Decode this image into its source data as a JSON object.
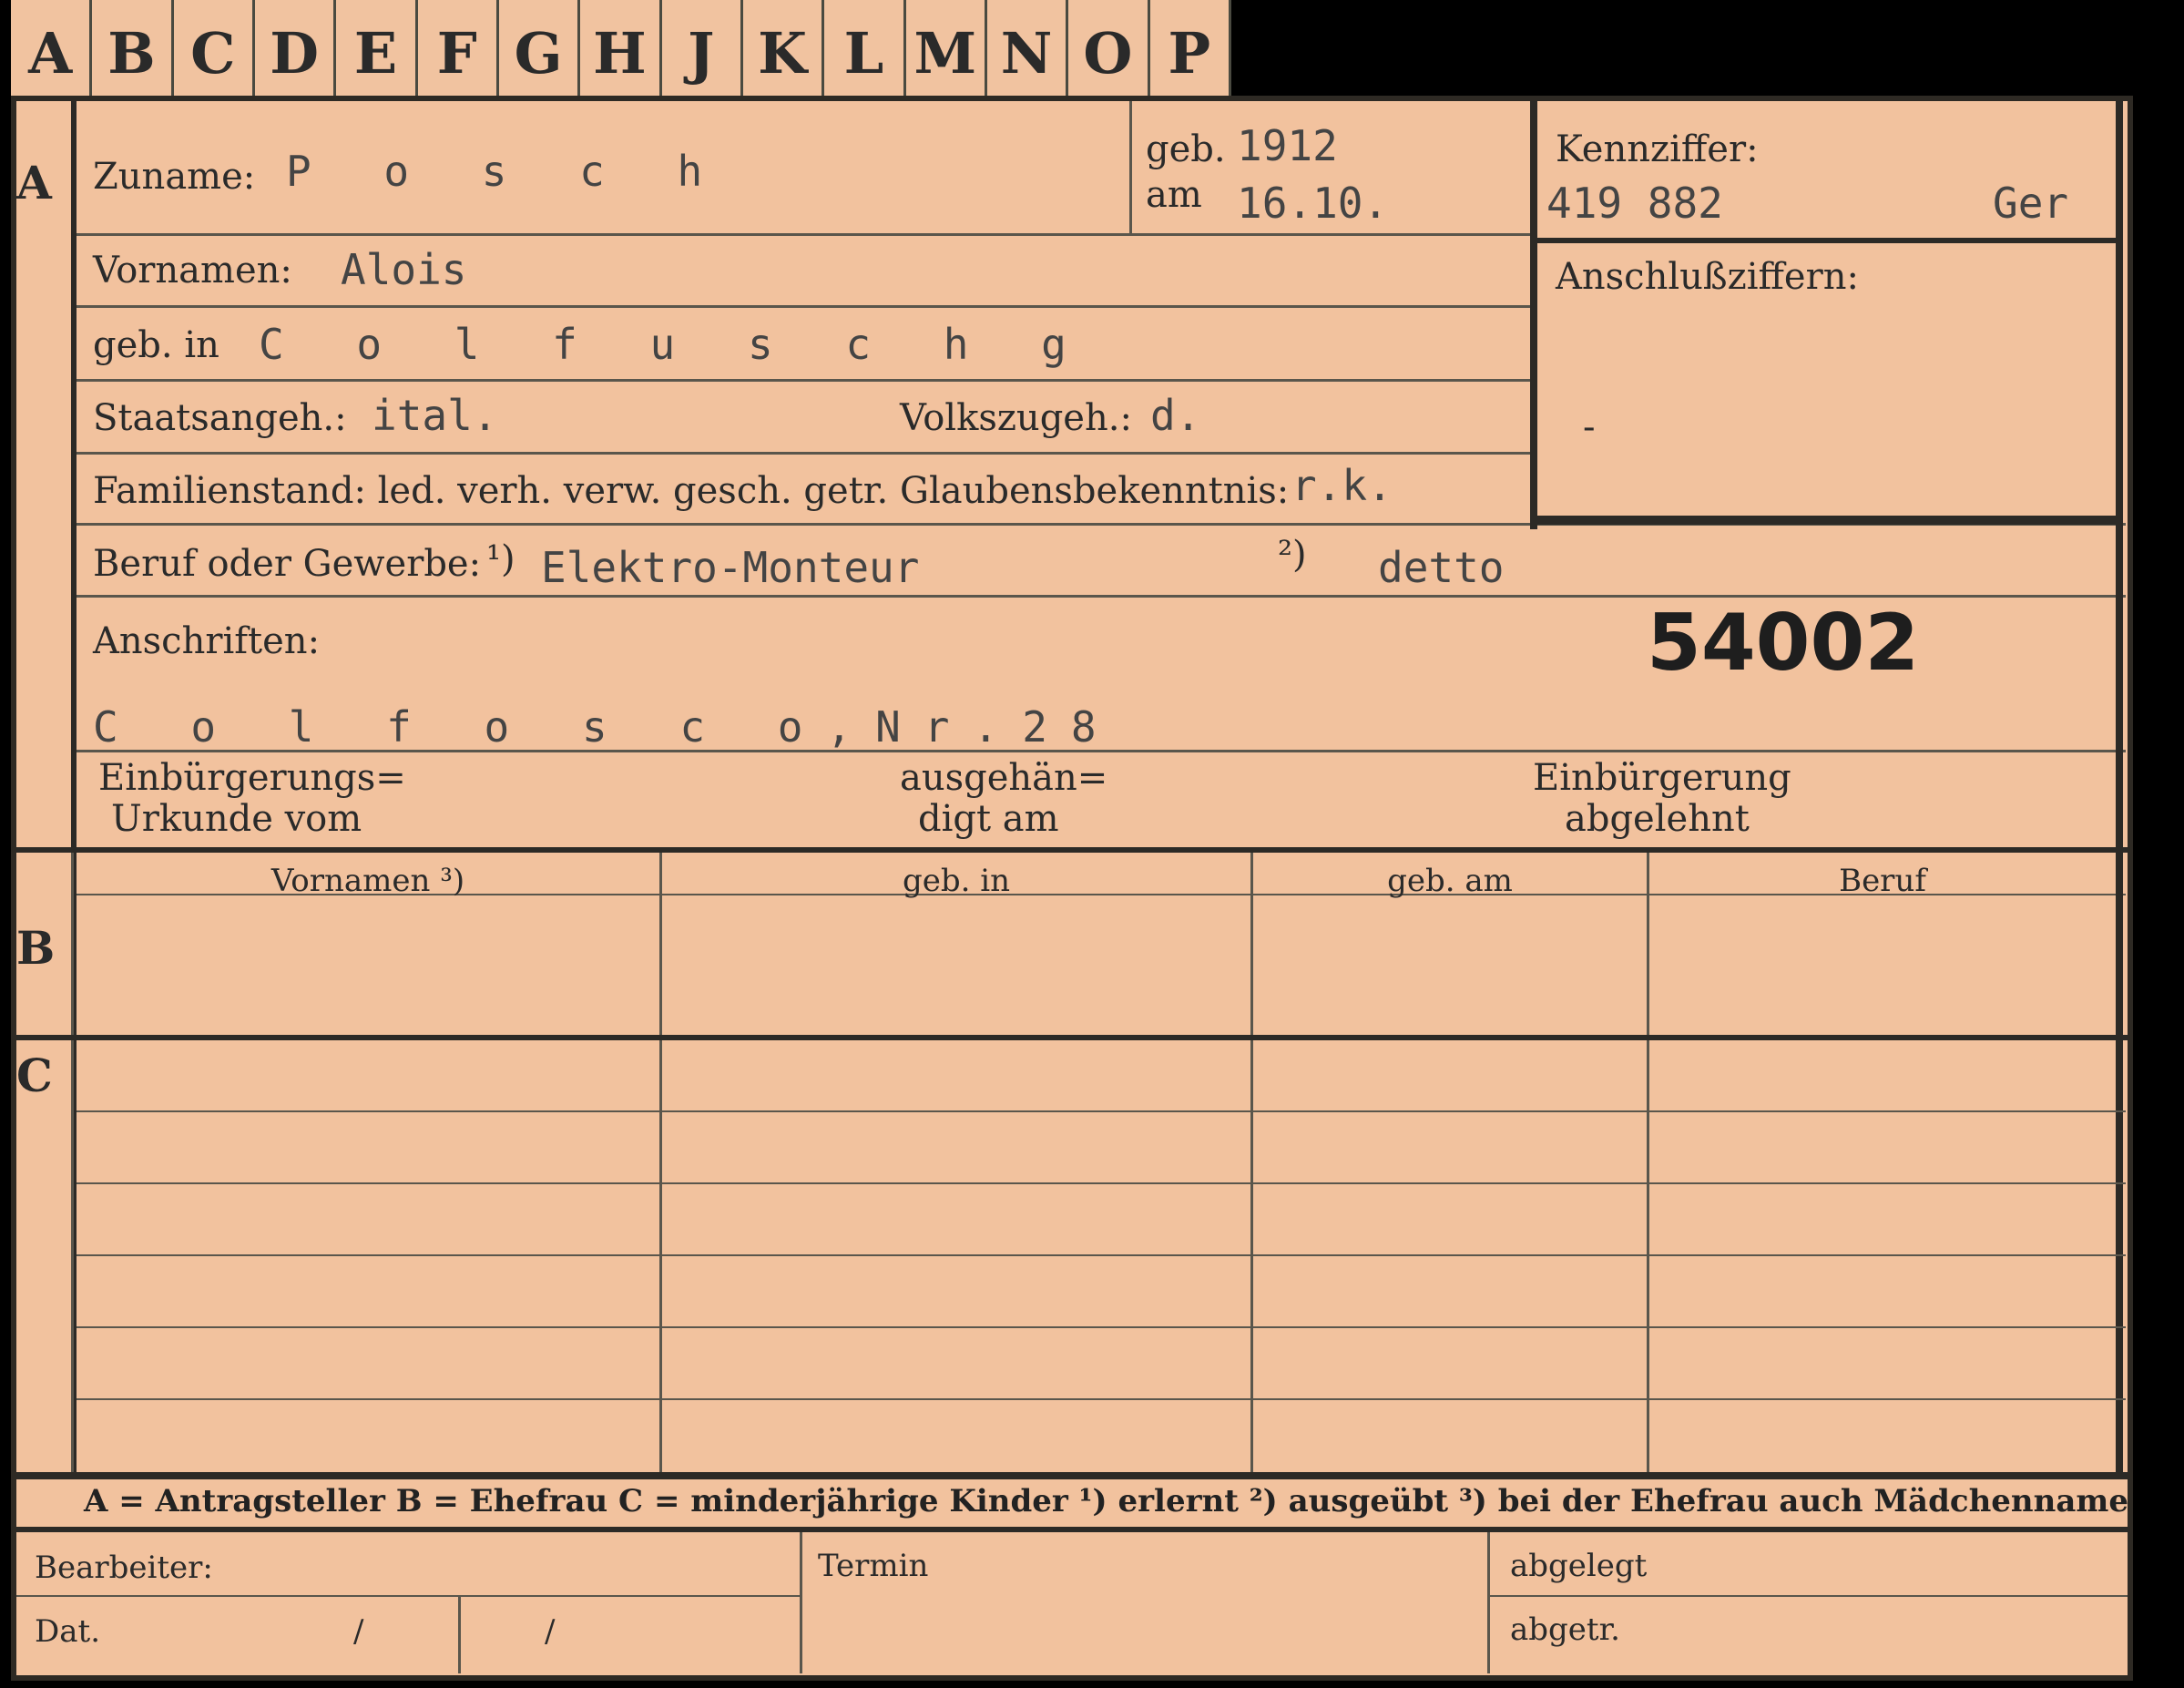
{
  "tabs": [
    "A",
    "B",
    "C",
    "D",
    "E",
    "F",
    "G",
    "H",
    "J",
    "K",
    "L",
    "M",
    "N",
    "O",
    "P"
  ],
  "sections": {
    "a": "A",
    "b": "B",
    "c": "C"
  },
  "applicant": {
    "surname_label": "Zuname:",
    "surname": "P o s c h",
    "born_label_1": "geb.",
    "born_label_2": "am",
    "birth_year": "1912",
    "birth_date": "16.10.",
    "first_names_label": "Vornamen:",
    "first_names": "Alois",
    "birthplace_label": "geb. in",
    "birthplace": "C o l f u s c h g",
    "citizenship_label": "Staatsangeh.:",
    "citizenship": "ital.",
    "ethnicity_label": "Volkszugeh.:",
    "ethnicity": "d.",
    "family_status_label": "Familienstand: led. verh. verw. gesch. getr.",
    "religion_label": "Glaubensbekenntnis:",
    "religion": "r.k.",
    "occupation_label": "Beruf oder Gewerbe:",
    "occupation_marker_1": "¹)",
    "occupation_learned": "Elektro-Monteur",
    "occupation_marker_2": "²)",
    "occupation_practiced": "detto",
    "addresses_label": "Anschriften:",
    "address": "C o l f o s c o,Nr.28",
    "file_number": "54002",
    "naturalization_label_1": "Einbürgerungs=",
    "naturalization_label_2": "Urkunde vom",
    "handed_label_1": "ausgehän=",
    "handed_label_2": "digt am",
    "refused_label_1": "Einbürgerung",
    "refused_label_2": "abgelehnt"
  },
  "id_box": {
    "code_label": "Kennziffer:",
    "code": "419 882",
    "code_suffix": "Ger",
    "connect_label": "Anschlußziffern:",
    "connect_mark": "-"
  },
  "table": {
    "headers": [
      "Vornamen ³)",
      "geb. in",
      "geb. am",
      "Beruf"
    ]
  },
  "legend": {
    "text": "A = Antragsteller   B = Ehefrau   C = minderjährige Kinder   ¹) erlernt   ²) ausgeübt   ³) bei der Ehefrau auch Mädchenname"
  },
  "footer": {
    "processor_label": "Bearbeiter:",
    "date_label": "Dat.",
    "slash": "/",
    "term_label": "Termin",
    "filed_label": "abgelegt",
    "removed_label": "abgetr."
  }
}
